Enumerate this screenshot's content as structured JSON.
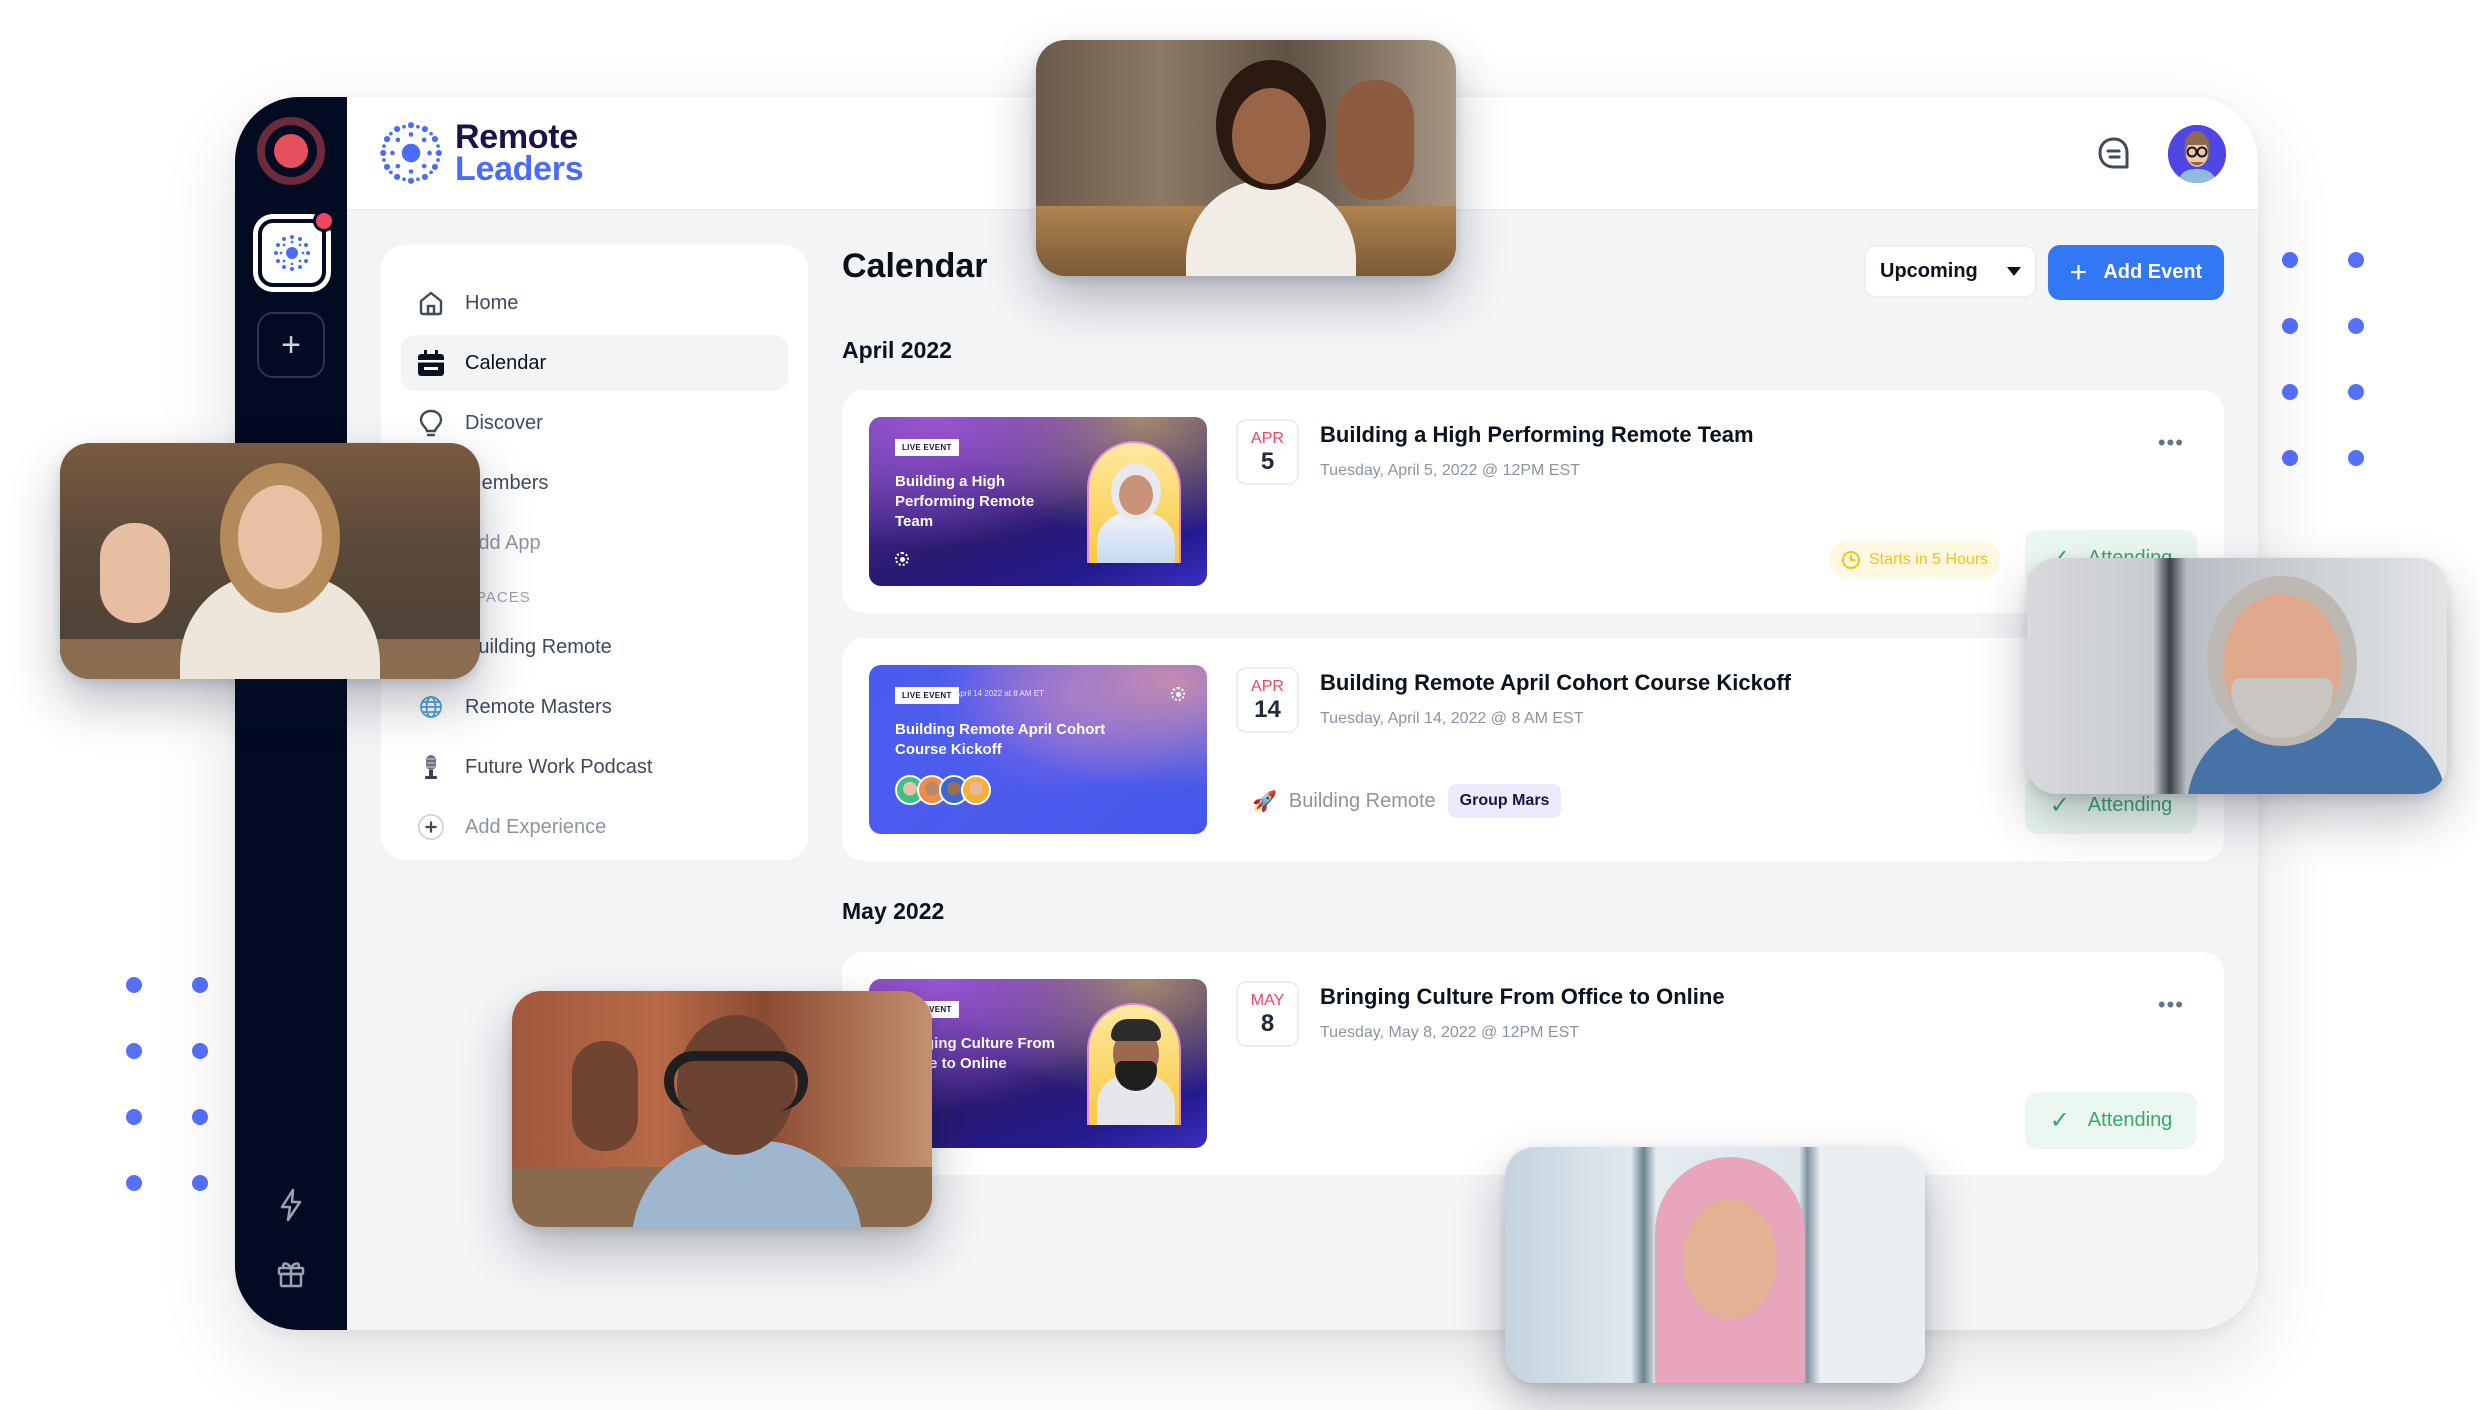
{
  "brand": {
    "name_line1": "Remote",
    "name_line2": "Leaders",
    "colors": {
      "primary": "#3278f5",
      "logo_dark": "#1a1446",
      "logo_blue": "#4a6cf7",
      "rail": "#020b21",
      "alert": "#ef4462",
      "attending": "#3aa86b",
      "pending": "#f4c21c"
    }
  },
  "rail": {
    "items": [
      {
        "icon": "record-icon"
      },
      {
        "icon": "community-app-icon",
        "has_notification": true
      },
      {
        "icon": "plus-icon",
        "label": "+"
      },
      {
        "icon": "lightning-icon"
      },
      {
        "icon": "gift-icon"
      }
    ]
  },
  "header": {
    "chat_icon": "chat-bubble-icon",
    "avatar": "user-avatar"
  },
  "nav": {
    "items": [
      {
        "label": "Home",
        "icon": "home-icon"
      },
      {
        "label": "Calendar",
        "icon": "calendar-icon",
        "active": true
      },
      {
        "label": "Discover",
        "icon": "lightbulb-icon"
      },
      {
        "label": "Members",
        "icon": "members-icon"
      },
      {
        "label": "Add App",
        "icon": "add-app-icon"
      }
    ],
    "section_label": "SPACES",
    "spaces": [
      {
        "label": "Building Remote",
        "icon": "rocket-icon"
      },
      {
        "label": "Remote Masters",
        "icon": "globe-icon"
      },
      {
        "label": "Future Work Podcast",
        "icon": "microphone-icon"
      }
    ],
    "add_experience": "Add Experience"
  },
  "main": {
    "title": "Calendar",
    "filter": {
      "selected": "Upcoming"
    },
    "add_event_label": "Add Event",
    "months": [
      {
        "label": "April 2022",
        "events": [
          {
            "thumb_tag": "LIVE EVENT",
            "thumb_title": "Building a High Performing Remote Team",
            "month": "APR",
            "day": "5",
            "title": "Building a High Performing Remote Team",
            "subtitle": "Tuesday, April 5, 2022 @ 12PM EST",
            "countdown": "Starts in 5 Hours",
            "status": "Attending"
          },
          {
            "thumb_tag": "LIVE EVENT",
            "thumb_date": "April 14 2022 at 8 AM ET",
            "thumb_title": "Building Remote April Cohort Course Kickoff",
            "month": "APR",
            "day": "14",
            "title": "Building Remote April Cohort Course Kickoff",
            "subtitle": "Tuesday, April 14, 2022 @ 8 AM EST",
            "community": "Building Remote",
            "group": "Group Mars",
            "status": "Attending"
          }
        ]
      },
      {
        "label": "May 2022",
        "events": [
          {
            "thumb_tag": "LIVE EVENT",
            "thumb_title": "Bringing Culture From Office to Online",
            "month": "MAY",
            "day": "8",
            "title": "Bringing Culture From Office to Online",
            "subtitle": "Tuesday, May 8, 2022 @ 12PM EST",
            "status": "Attending"
          }
        ]
      }
    ],
    "more_label": "•••",
    "check_glyph": "✓"
  },
  "video_tiles": [
    {
      "label": "woman-waving-top"
    },
    {
      "label": "woman-waving-left"
    },
    {
      "label": "man-smiling-right"
    },
    {
      "label": "man-headphones-waving"
    },
    {
      "label": "woman-hijab-smiling"
    }
  ]
}
